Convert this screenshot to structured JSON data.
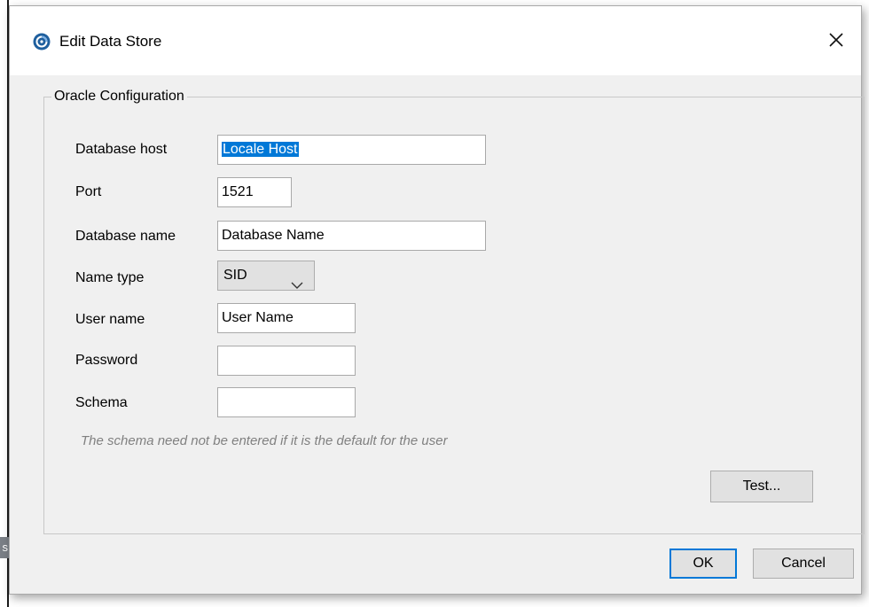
{
  "dialog": {
    "title": "Edit Data Store",
    "close_icon": "close-icon",
    "app_icon": "datastore-app-icon"
  },
  "group": {
    "label": "Oracle Configuration"
  },
  "form": {
    "database_host": {
      "label": "Database host",
      "value": "Locale Host"
    },
    "port": {
      "label": "Port",
      "value": "1521"
    },
    "database_name": {
      "label": "Database name",
      "value": "Database Name"
    },
    "name_type": {
      "label": "Name type",
      "value": "SID"
    },
    "user_name": {
      "label": "User name",
      "value": "User Name"
    },
    "password": {
      "label": "Password",
      "value": ""
    },
    "schema": {
      "label": "Schema",
      "value": ""
    },
    "hint": "The schema need not be entered if it is the default for the user"
  },
  "buttons": {
    "test": "Test...",
    "ok": "OK",
    "cancel": "Cancel"
  },
  "background_fragment": "s",
  "colors": {
    "selection": "#0078d7",
    "dialog_bg": "#f0f0f0",
    "icon_accent": "#1f5f9e"
  }
}
